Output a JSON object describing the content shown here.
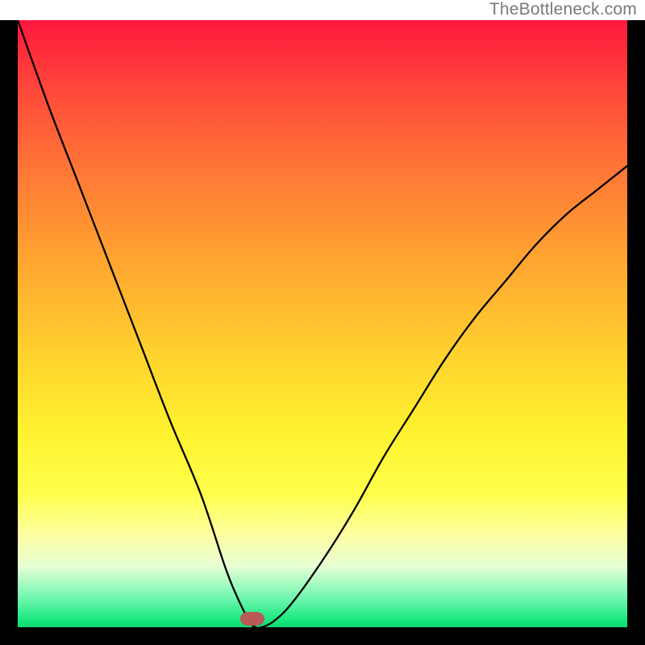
{
  "watermark": "TheBottleneck.com",
  "chart_data": {
    "type": "line",
    "title": "",
    "xlabel": "",
    "ylabel": "",
    "xlim": [
      0,
      100
    ],
    "ylim": [
      0,
      100
    ],
    "grid": false,
    "series": [
      {
        "name": "bottleneck-curve",
        "x": [
          0,
          5,
          10,
          15,
          20,
          25,
          30,
          34,
          36,
          38,
          39,
          40,
          42,
          45,
          50,
          55,
          60,
          65,
          70,
          75,
          80,
          85,
          90,
          95,
          100
        ],
        "values": [
          100,
          86,
          73,
          60,
          47,
          34,
          22,
          10,
          5,
          1,
          0,
          0,
          1,
          4,
          11,
          19,
          28,
          36,
          44,
          51,
          57,
          63,
          68,
          72,
          76
        ]
      }
    ],
    "marker": {
      "name": "optimal-region",
      "x": 39,
      "y": 0
    },
    "background": {
      "description": "vertical gradient red→orange→yellow→green representing bottleneck severity",
      "stops": [
        {
          "pos": 0,
          "color": "#ff173e"
        },
        {
          "pos": 50,
          "color": "#ffd22e"
        },
        {
          "pos": 78,
          "color": "#ffff4c"
        },
        {
          "pos": 100,
          "color": "#0fd973"
        }
      ]
    }
  }
}
